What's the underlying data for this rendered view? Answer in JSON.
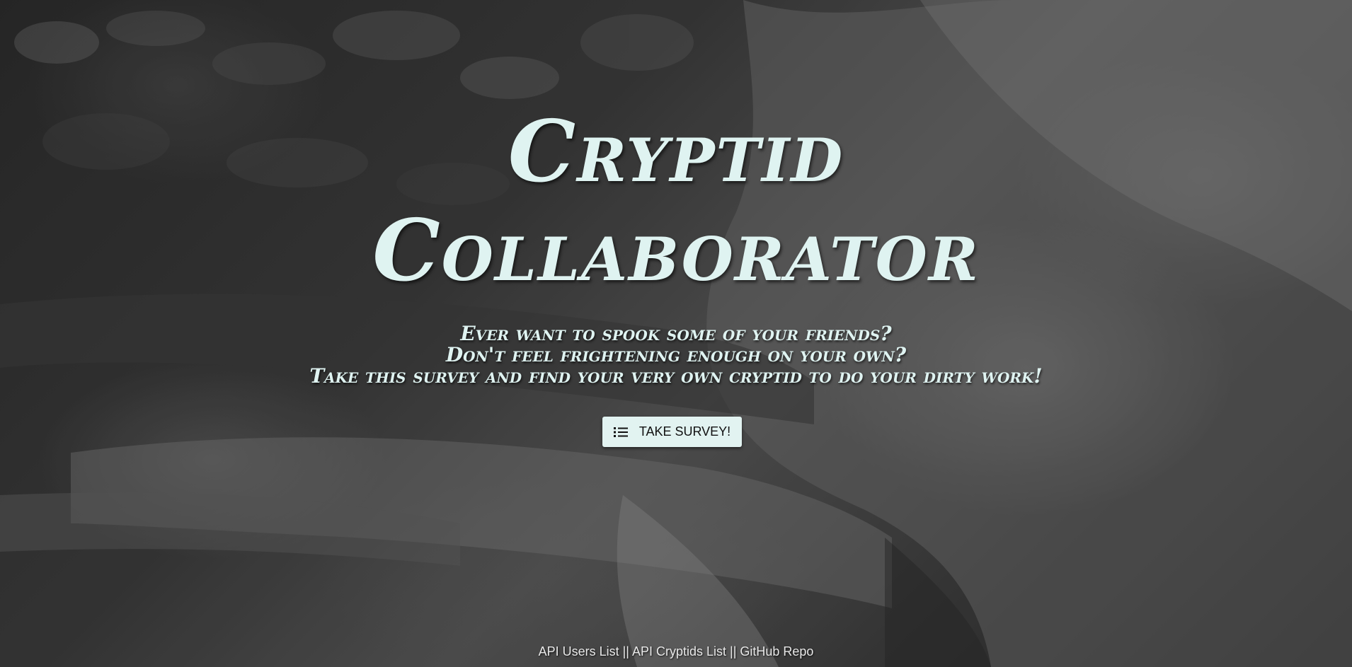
{
  "hero": {
    "title_line1": "Cryptid",
    "title_line2": "Collaborator",
    "tagline": [
      "Ever want to spook some of your friends?",
      "Don't feel frightening enough on your own?",
      "Take this survey and find your very own cryptid to do your dirty work!"
    ],
    "survey_button_label": "TAKE SURVEY!",
    "survey_button_icon": "list-icon"
  },
  "footer": {
    "links": [
      {
        "label": "API Users List"
      },
      {
        "label": "API Cryptids List"
      },
      {
        "label": "GitHub Repo"
      }
    ],
    "separator": " || "
  },
  "colors": {
    "title_text": "#dff3f1",
    "button_bg": "#e2f3f1",
    "footer_text": "#e8e8e8"
  }
}
